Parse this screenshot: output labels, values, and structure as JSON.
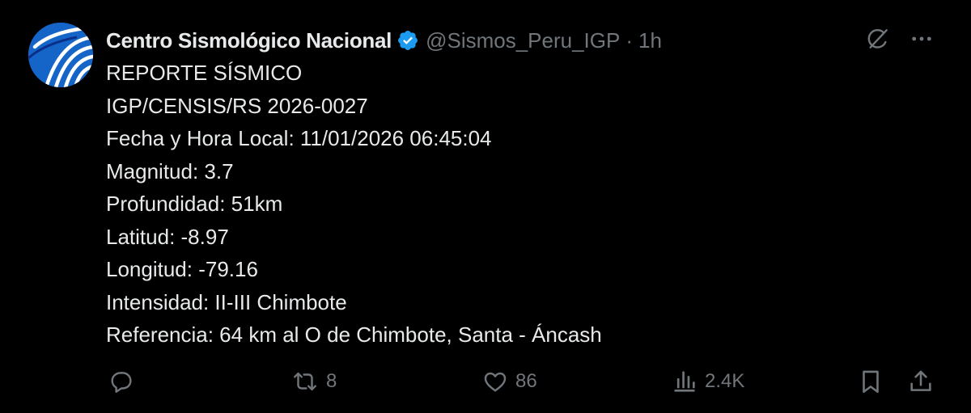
{
  "author": {
    "display_name": "Centro Sismológico Nacional",
    "handle": "@Sismos_Peru_IGP",
    "separator": "·",
    "time": "1h"
  },
  "body_lines": [
    "REPORTE SÍSMICO",
    "IGP/CENSIS/RS 2026-0027",
    "Fecha y Hora Local: 11/01/2026 06:45:04",
    "Magnitud: 3.7",
    "Profundidad: 51km",
    "Latitud: -8.97",
    "Longitud: -79.16",
    "Intensidad: II-III Chimbote",
    "Referencia: 64 km al O de Chimbote, Santa - Áncash"
  ],
  "stats": {
    "reply_count": "",
    "retweet_count": "8",
    "like_count": "86",
    "view_count": "2.4K"
  },
  "icons": {
    "verified": "verified-badge-icon",
    "grok": "grok-icon",
    "more": "more-options-icon",
    "reply": "reply-icon",
    "retweet": "retweet-icon",
    "like": "like-icon",
    "views": "views-icon",
    "bookmark": "bookmark-icon",
    "share": "share-icon"
  },
  "colors": {
    "background": "#000000",
    "primary_text": "#e7e9ea",
    "secondary_text": "#71767b",
    "verified_blue": "#1d9bf0"
  }
}
